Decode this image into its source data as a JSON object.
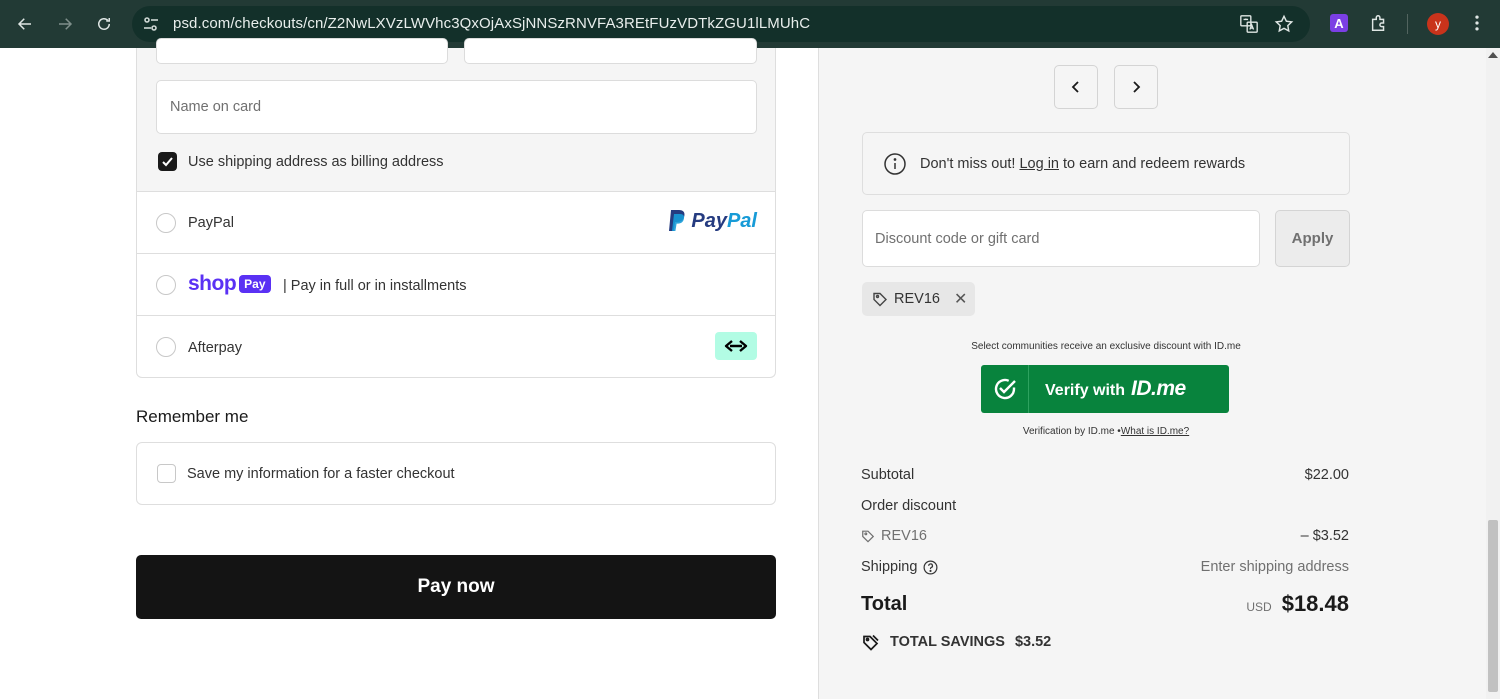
{
  "browser": {
    "url": "psd.com/checkouts/cn/Z2NwLXVzLWVhc3QxOjAxSjNNSzRNVFA3REtFUzVDTkZGU1lLMUhC",
    "profile_initial": "y",
    "extension_letter": "A"
  },
  "payment": {
    "name_on_card_placeholder": "Name on card",
    "billing_checkbox_label": "Use shipping address as billing address",
    "billing_checked": true,
    "options": {
      "paypal": {
        "label": "PayPal",
        "logo_pay": "Pay",
        "logo_pal": "Pal"
      },
      "shoppay": {
        "logo_shop": "shop",
        "logo_pay": "Pay",
        "label": "| Pay in full or in installments"
      },
      "afterpay": {
        "label": "Afterpay"
      }
    }
  },
  "remember": {
    "heading": "Remember me",
    "checkbox_label": "Save my information for a faster checkout",
    "checked": false
  },
  "pay_button": "Pay now",
  "summary": {
    "rewards": {
      "prefix": "Don't miss out! ",
      "link": "Log in",
      "suffix": " to earn and redeem rewards"
    },
    "discount_placeholder": "Discount code or gift card",
    "apply_label": "Apply",
    "applied_code": "REV16",
    "idme": {
      "note": "Select communities receive an exclusive discount with ID.me",
      "button_label": "Verify with",
      "brand": "ID.me",
      "footer_prefix": "Verification by ID.me •",
      "footer_link": "What is ID.me?"
    },
    "lines": {
      "subtotal_label": "Subtotal",
      "subtotal_value": "$22.00",
      "order_discount_label": "Order discount",
      "discount_code": "REV16",
      "discount_value": "– $3.52",
      "shipping_label": "Shipping",
      "shipping_value": "Enter shipping address"
    },
    "total": {
      "label": "Total",
      "currency": "USD",
      "amount": "$18.48"
    },
    "savings": {
      "label": "TOTAL SAVINGS",
      "amount": "$3.52"
    }
  },
  "colors": {
    "browser_bar": "#223a35",
    "pay_button": "#141414",
    "shop_pay": "#5a31f4",
    "idme_green": "#08833d",
    "afterpay_mint": "#b2fce4"
  }
}
